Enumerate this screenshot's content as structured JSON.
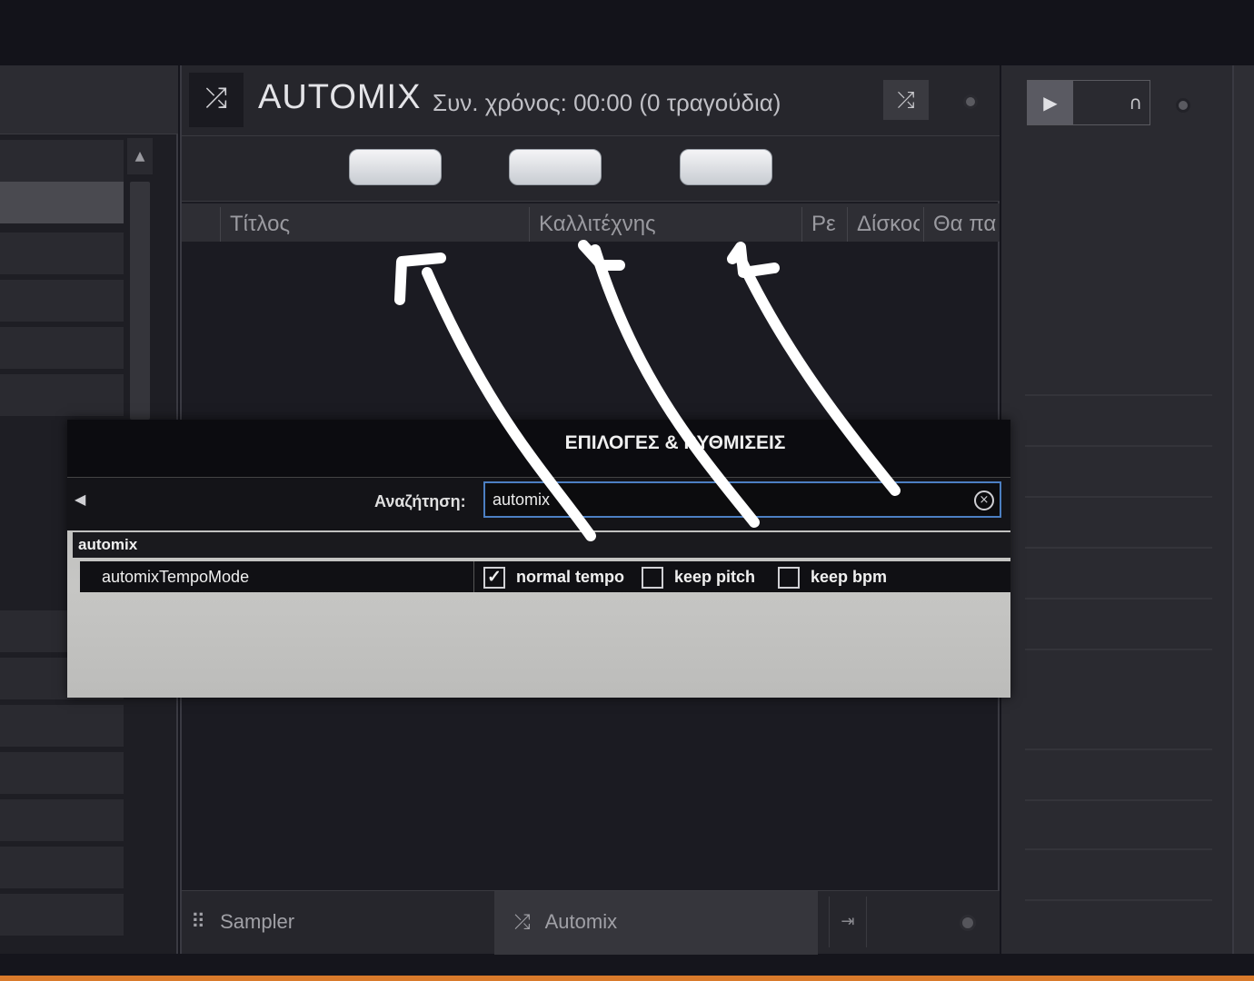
{
  "automix_panel": {
    "title": "AUTOMIX",
    "subtitle": "Συν. χρόνος: 00:00 (0 τραγούδια)",
    "columns": [
      "Τίτλος",
      "Καλλιτέχνης",
      "Ρε",
      "Δίσκος",
      "Θα παί"
    ]
  },
  "bottom_bar": {
    "sampler_label": "Sampler",
    "automix_label": "Automix"
  },
  "dialog": {
    "title": "ΕΠΙΛΟΓΕΣ & ΡΥΘΜΙΣΕΙΣ",
    "search_label": "Αναζήτηση:",
    "search_value": "automix",
    "group": "automix",
    "setting_name": "automixTempoMode",
    "options": [
      {
        "label": "normal tempo",
        "checked": true
      },
      {
        "label": "keep pitch",
        "checked": false
      },
      {
        "label": "keep bpm",
        "checked": false
      }
    ]
  },
  "icons": {
    "shuffle": "shuffle-icon",
    "play": "play-icon",
    "headphones": "headphones-icon",
    "grid": "grid-icon"
  },
  "colors": {
    "accent_focus": "#4c7fc2",
    "annotation_arrow": "#ffffff",
    "bottom_strip": "#d97a2b"
  }
}
